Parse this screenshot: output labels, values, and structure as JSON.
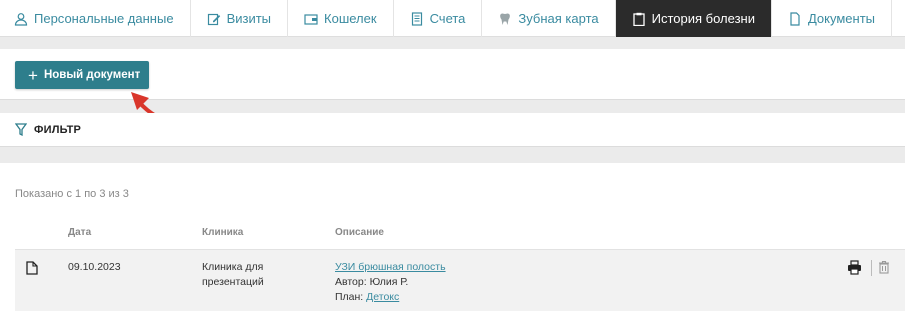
{
  "tabs": [
    {
      "label": "Персональные данные",
      "icon": "person-icon"
    },
    {
      "label": "Визиты",
      "icon": "edit-icon"
    },
    {
      "label": "Кошелек",
      "icon": "wallet-icon"
    },
    {
      "label": "Счета",
      "icon": "invoice-icon"
    },
    {
      "label": "Зубная карта",
      "icon": "tooth-icon"
    },
    {
      "label": "История болезни",
      "icon": "clipboard-icon",
      "active": true
    },
    {
      "label": "Документы",
      "icon": "document-icon"
    }
  ],
  "toolbar": {
    "new_document_label": "Новый документ"
  },
  "filter": {
    "label": "ФИЛЬТР"
  },
  "list": {
    "shown_text": "Показано с 1 по 3 из 3",
    "columns": {
      "date": "Дата",
      "clinic": "Клиника",
      "description": "Описание"
    },
    "rows": [
      {
        "date": "09.10.2023",
        "clinic_line1": "Клиника для",
        "clinic_line2": "презентаций",
        "title": "УЗИ брюшная полость",
        "author_label": "Автор:",
        "author": "Юлия Р.",
        "plan_label": "План:",
        "plan": "Детокс"
      }
    ]
  },
  "colors": {
    "accent": "#2e7e8c",
    "link": "#3a8ba0",
    "active_tab": "#2b2b2b",
    "arrow": "#d9362b"
  }
}
